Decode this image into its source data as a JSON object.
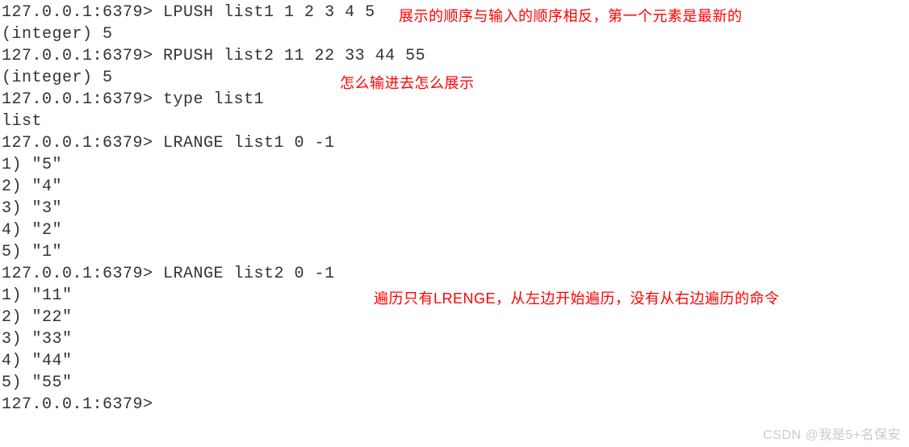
{
  "lines": {
    "l0_prompt": "127.0.0.1:6379> ",
    "l0_cmd": "LPUSH list1 1 2 3 4 5",
    "l1": "(integer) 5",
    "l2_prompt": "127.0.0.1:6379> ",
    "l2_cmd": "RPUSH list2 11 22 33 44 55",
    "l3": "(integer) 5",
    "l4_prompt": "127.0.0.1:6379> ",
    "l4_cmd": "type list1",
    "l5": "list",
    "l6_prompt": "127.0.0.1:6379> ",
    "l6_cmd": "LRANGE list1 0 -1",
    "l7": "1) \"5\"",
    "l8": "2) \"4\"",
    "l9": "3) \"3\"",
    "l10": "4) \"2\"",
    "l11": "5) \"1\"",
    "l12_prompt": "127.0.0.1:6379> ",
    "l12_cmd": "LRANGE list2 0 -1",
    "l13": "1) \"11\"",
    "l14": "2) \"22\"",
    "l15": "3) \"33\"",
    "l16": "4) \"44\"",
    "l17": "5) \"55\"",
    "l18_prompt": "127.0.0.1:6379>"
  },
  "annotations": {
    "a1": "展示的顺序与输入的顺序相反，第一个元素是最新的",
    "a2": "怎么输进去怎么展示",
    "a3": "遍历只有LRENGE，从左边开始遍历，没有从右边遍历的命令"
  },
  "watermark": "CSDN @我是5+名保安"
}
